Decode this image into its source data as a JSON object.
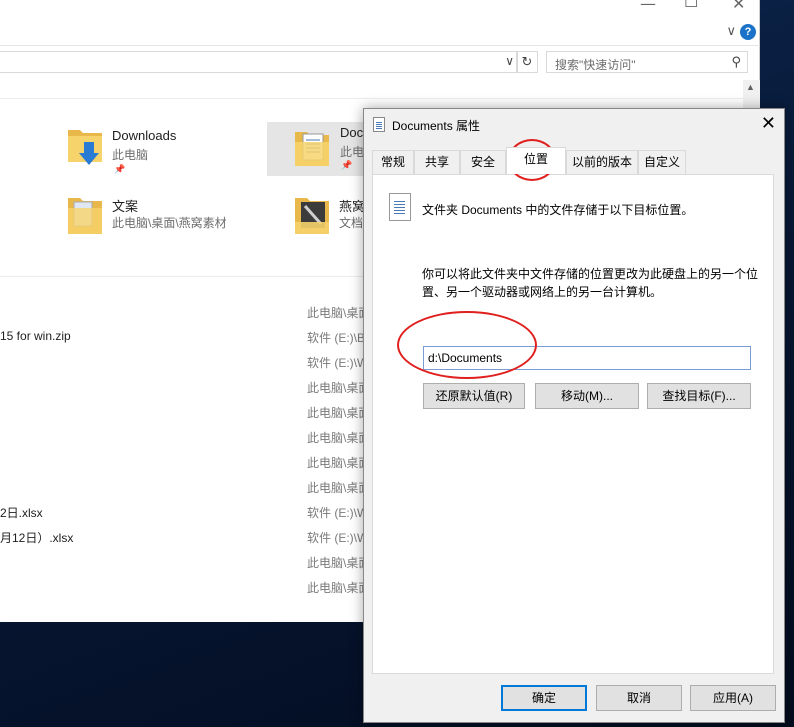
{
  "explorer": {
    "search_placeholder": "搜索\"快速访问\"",
    "quick_access": [
      {
        "title": "Downloads",
        "sub": "此电脑"
      },
      {
        "title": "Doc",
        "sub": "此电"
      },
      {
        "title": "文案",
        "sub": "此电脑\\桌面\\燕窝素材"
      },
      {
        "title": "燕窝",
        "sub": "文档"
      }
    ],
    "recent_names": [
      "15 for win.zip",
      "2日.xlsx",
      "月12日）.xlsx"
    ],
    "recent_paths": [
      "此电脑\\桌面",
      "软件 (E:)\\B",
      "软件 (E:)\\W",
      "此电脑\\桌面",
      "此电脑\\桌面",
      "此电脑\\桌面",
      "此电脑\\桌面",
      "此电脑\\桌面",
      "软件 (E:)\\W",
      "软件 (E:)\\W",
      "此电脑\\桌面",
      "此电脑\\桌面"
    ]
  },
  "dialog": {
    "title": "Documents 属性",
    "tabs": [
      "常规",
      "共享",
      "安全",
      "位置",
      "以前的版本",
      "自定义"
    ],
    "active_tab": "位置",
    "heading": "文件夹 Documents 中的文件存储于以下目标位置。",
    "description": "你可以将此文件夹中文件存储的位置更改为此硬盘上的另一个位置、另一个驱动器或网络上的另一台计算机。",
    "path_value": "d:\\Documents",
    "buttons": {
      "restore": "还原默认值(R)",
      "move": "移动(M)...",
      "find_target": "查找目标(F)...",
      "ok": "确定",
      "cancel": "取消",
      "apply": "应用(A)"
    }
  },
  "colors": {
    "accent": "#0078d7",
    "annotation": "#e0201e",
    "help_icon": "#1a73c8"
  }
}
